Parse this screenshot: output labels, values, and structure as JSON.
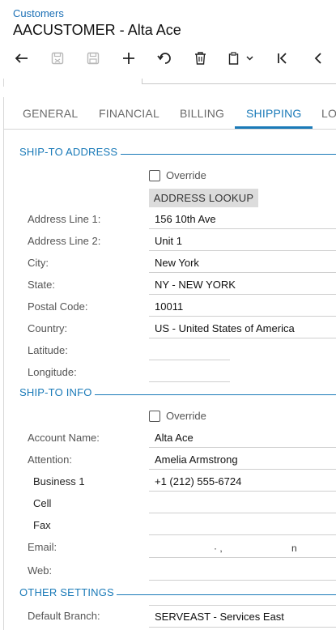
{
  "header": {
    "breadcrumb": "Customers",
    "title": "AACUSTOMER - Alta Ace"
  },
  "toolbar": {
    "buttons": [
      {
        "name": "back-icon",
        "enabled": true
      },
      {
        "name": "save-close-icon",
        "enabled": false
      },
      {
        "name": "save-icon",
        "enabled": false
      },
      {
        "name": "add-icon",
        "enabled": true
      },
      {
        "name": "undo-icon",
        "enabled": true
      },
      {
        "name": "delete-icon",
        "enabled": true
      },
      {
        "name": "copy-paste-icon",
        "enabled": true
      },
      {
        "name": "first-record-icon",
        "enabled": true
      },
      {
        "name": "previous-record-icon",
        "enabled": true
      }
    ]
  },
  "tabs": [
    {
      "label": "GENERAL",
      "active": false
    },
    {
      "label": "FINANCIAL",
      "active": false
    },
    {
      "label": "BILLING",
      "active": false
    },
    {
      "label": "SHIPPING",
      "active": true
    },
    {
      "label": "LO",
      "active": false
    }
  ],
  "ship_to_address": {
    "heading": "SHIP-TO ADDRESS",
    "override_label": "Override",
    "override_checked": false,
    "lookup_label": "ADDRESS LOOKUP",
    "fields": [
      {
        "label": "Address Line 1:",
        "value": "156 10th Ave"
      },
      {
        "label": "Address Line 2:",
        "value": "Unit 1"
      },
      {
        "label": "City:",
        "value": "New York"
      },
      {
        "label": "State:",
        "value": "NY - NEW YORK"
      },
      {
        "label": "Postal Code:",
        "value": "10011"
      },
      {
        "label": "Country:",
        "value": "US - United States of America"
      },
      {
        "label": "Latitude:",
        "value": ""
      },
      {
        "label": "Longitude:",
        "value": ""
      }
    ]
  },
  "ship_to_info": {
    "heading": "SHIP-TO INFO",
    "override_label": "Override",
    "override_checked": false,
    "fields": [
      {
        "label": "Account Name:",
        "value": "Alta Ace"
      },
      {
        "label": "Attention:",
        "value": "Amelia Armstrong"
      },
      {
        "label": "Business 1",
        "value": "+1 (212) 555-6724"
      },
      {
        "label": "Cell",
        "value": ""
      },
      {
        "label": "Fax",
        "value": ""
      },
      {
        "label": "Email:",
        "value": ""
      },
      {
        "label": "Web:",
        "value": ""
      }
    ],
    "email_fragments": [
      "· ,",
      "n"
    ]
  },
  "other_settings": {
    "heading": "OTHER SETTINGS",
    "fields": [
      {
        "label": "Default Branch:",
        "value": "SERVEAST - Services East"
      }
    ]
  },
  "colors": {
    "accent": "#1a7ab8",
    "link": "#1a6fb5",
    "button_gray": "#dcdcdc",
    "disabled_icon": "#b8b8b8"
  }
}
